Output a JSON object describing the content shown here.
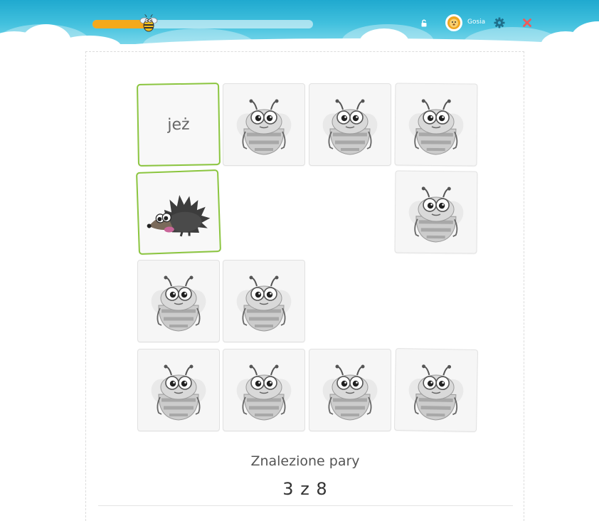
{
  "header": {
    "progress": 0.27,
    "user_name": "Gosia",
    "lock_icon": "lock-icon",
    "avatar_icon": "lion-avatar-icon",
    "settings_icon": "gear-icon",
    "close_icon": "close-icon",
    "colors": {
      "bar": "#1fa9cf",
      "progress": "#f4a91c",
      "gear": "#1e6e8a",
      "close": "#f05a5a"
    }
  },
  "board": {
    "card_back_icon": "bee-icon",
    "card_border_revealed": "#8bc53f",
    "cards": [
      {
        "row": 0,
        "col": 0,
        "state": "revealed",
        "kind": "word",
        "word": "jeż"
      },
      {
        "row": 0,
        "col": 1,
        "state": "hidden"
      },
      {
        "row": 0,
        "col": 2,
        "state": "hidden"
      },
      {
        "row": 0,
        "col": 3,
        "state": "hidden"
      },
      {
        "row": 1,
        "col": 0,
        "state": "revealed",
        "kind": "picture",
        "icon": "hedgehog-icon"
      },
      {
        "row": 1,
        "col": 3,
        "state": "hidden"
      },
      {
        "row": 2,
        "col": 0,
        "state": "hidden"
      },
      {
        "row": 2,
        "col": 1,
        "state": "hidden"
      },
      {
        "row": 3,
        "col": 0,
        "state": "hidden"
      },
      {
        "row": 3,
        "col": 1,
        "state": "hidden"
      },
      {
        "row": 3,
        "col": 2,
        "state": "hidden"
      },
      {
        "row": 3,
        "col": 3,
        "state": "hidden"
      }
    ]
  },
  "score": {
    "label": "Znalezione pary",
    "value": "3 z 8"
  }
}
